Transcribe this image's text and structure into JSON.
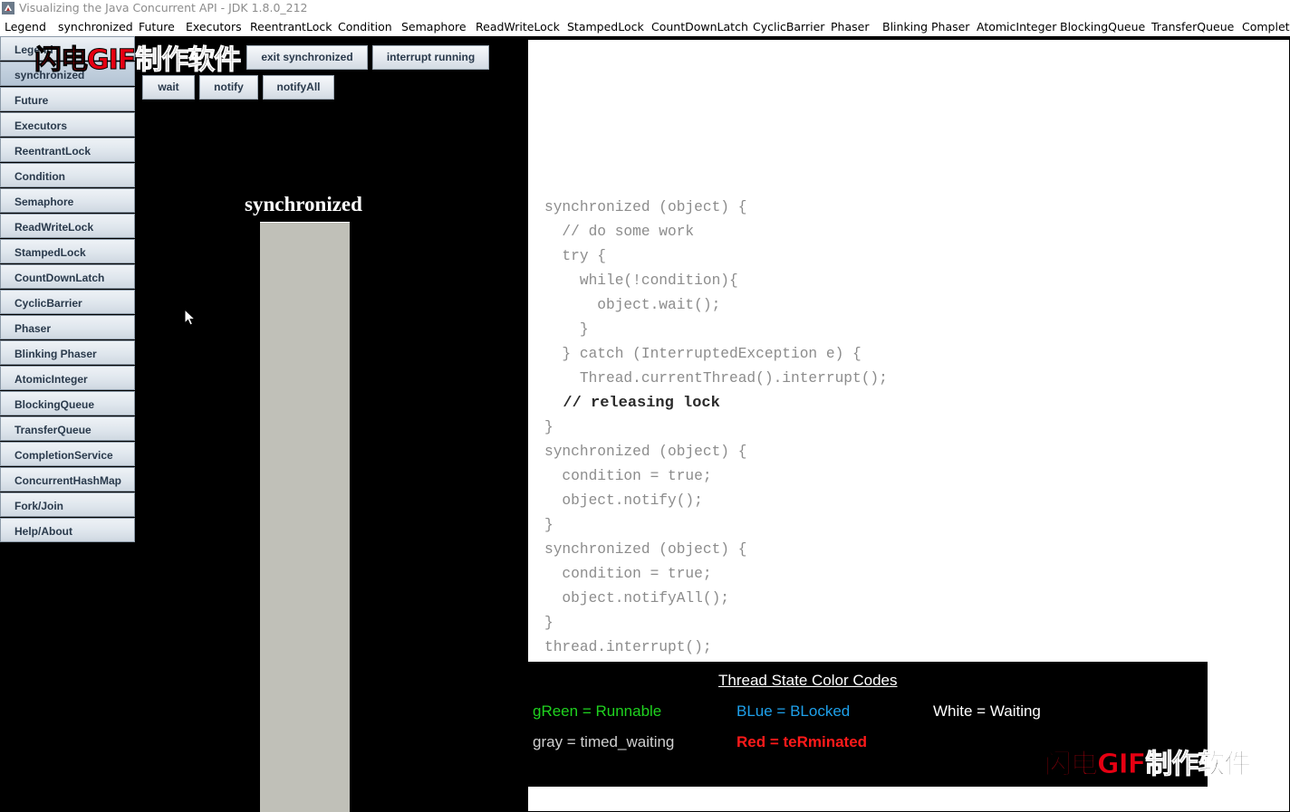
{
  "window": {
    "title": "Visualizing the Java Concurrent API - JDK 1.8.0_212"
  },
  "menu": [
    "Legend",
    "synchronized",
    "Future",
    "Executors",
    "ReentrantLock",
    "Condition",
    "Semaphore",
    "ReadWriteLock",
    "StampedLock",
    "CountDownLatch",
    "CyclicBarrier",
    "Phaser",
    "Blinking Phaser",
    "AtomicInteger",
    "BlockingQueue",
    "TransferQueue",
    "Completi"
  ],
  "sidebar": [
    "Legend",
    "synchronized",
    "Future",
    "Executors",
    "ReentrantLock",
    "Condition",
    "Semaphore",
    "ReadWriteLock",
    "StampedLock",
    "CountDownLatch",
    "CyclicBarrier",
    "Phaser",
    "Blinking Phaser",
    "AtomicInteger",
    "BlockingQueue",
    "TransferQueue",
    "CompletionService",
    "ConcurrentHashMap",
    "Fork/Join",
    "Help/About"
  ],
  "sidebar_selected": "synchronized",
  "controls": {
    "exit_synchronized": "exit synchronized",
    "interrupt_running": "interrupt running",
    "wait": "wait",
    "notify": "notify",
    "notify_all": "notifyAll"
  },
  "watermark": {
    "red": "闪电GIF",
    "black": "制作软件"
  },
  "panel": {
    "title": "synchronized"
  },
  "code": [
    "synchronized (object) {",
    "  // do some work",
    "  try {",
    "    while(!condition){",
    "      object.wait();",
    "    }",
    "  } catch (InterruptedException e) {",
    "    Thread.currentThread().interrupt();",
    "  // releasing lock",
    "}",
    "synchronized (object) {",
    "  condition = true;",
    "  object.notify();",
    "}",
    "synchronized (object) {",
    "  condition = true;",
    "  object.notifyAll();",
    "}",
    "thread.interrupt();"
  ],
  "code_highlight_line": 8,
  "legend": {
    "title": "Thread State Color Codes",
    "items": [
      {
        "text": "gReen = Runnable",
        "color": "#1fd21f"
      },
      {
        "text": "BLue = BLocked",
        "color": "#1ea0ea"
      },
      {
        "text": "White = Waiting",
        "color": "#ffffff"
      },
      {
        "text": "gray = timed_waiting",
        "color": "#d0d0d0"
      },
      {
        "text": "Red = teRminated",
        "color": "#ff1a1a"
      }
    ]
  }
}
